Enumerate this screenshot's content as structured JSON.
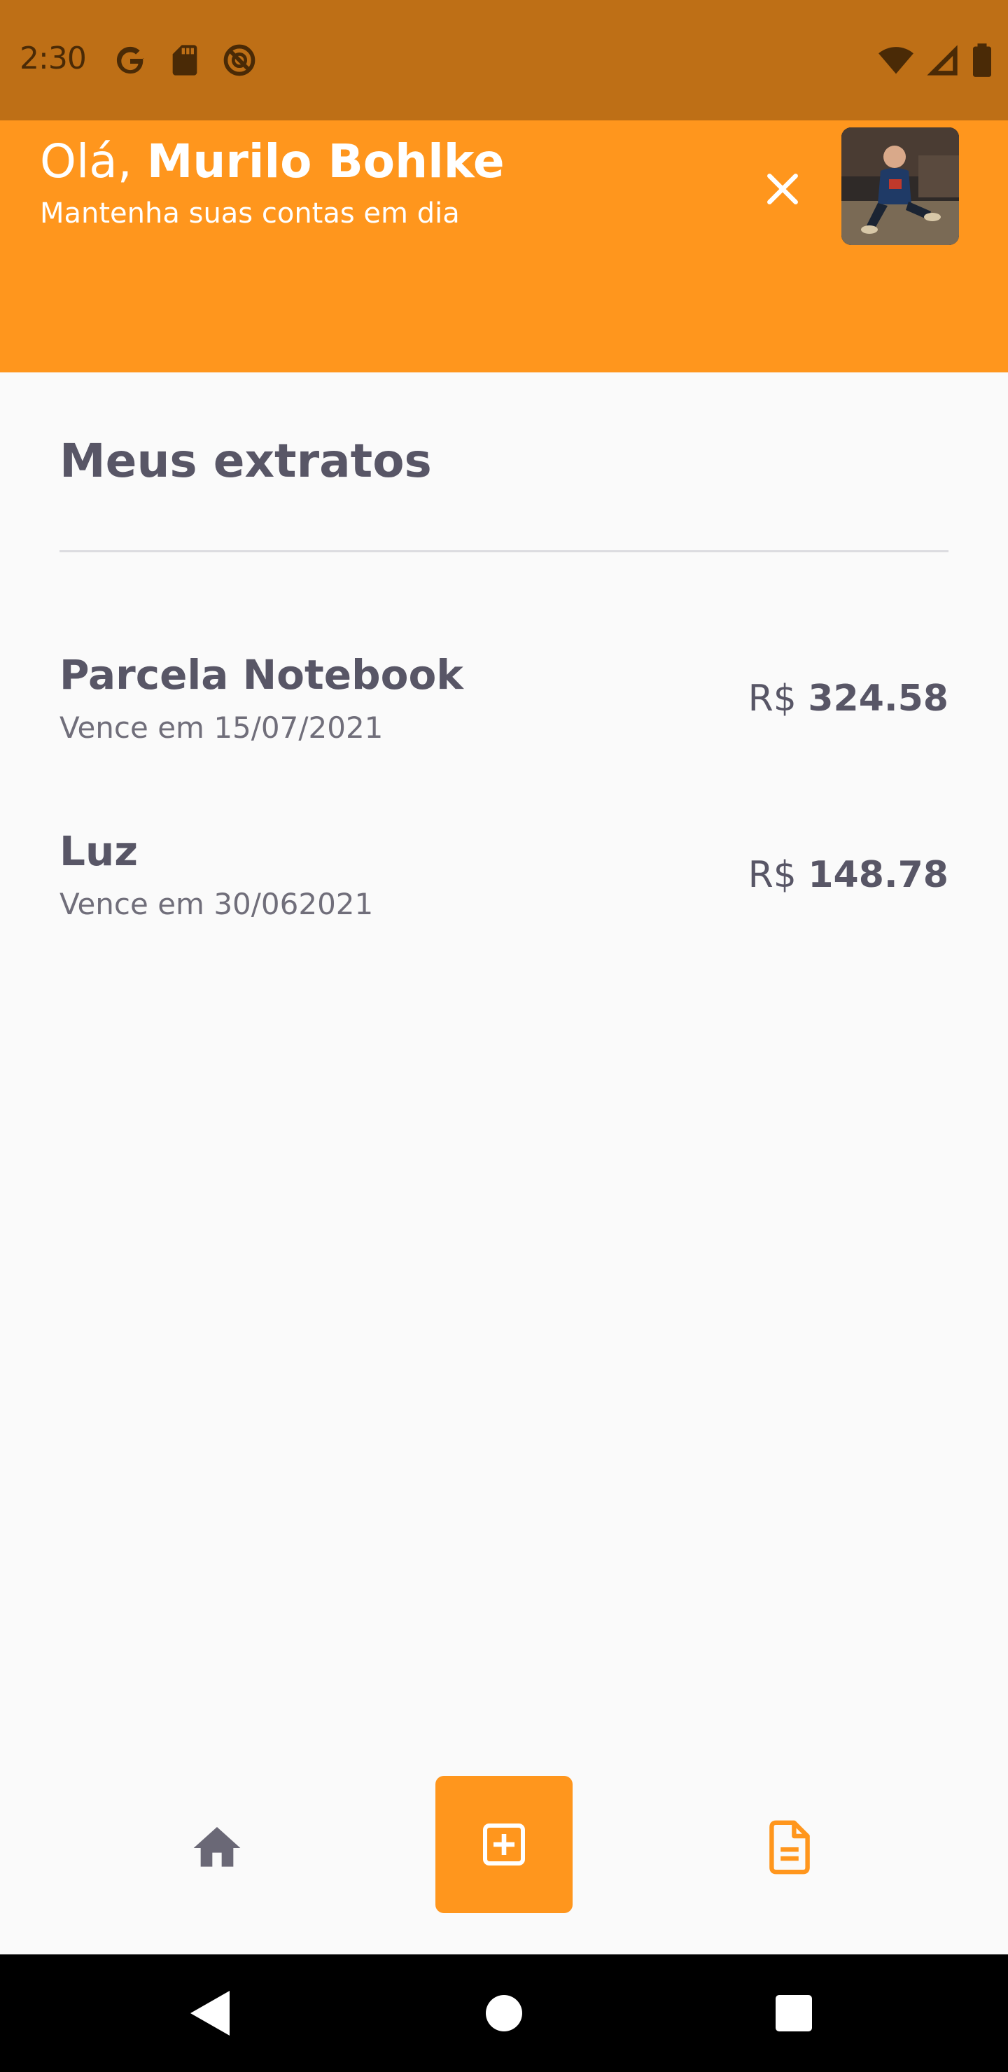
{
  "status_bar": {
    "time": "2:30",
    "left_icons": [
      "google-icon",
      "sd-card-icon",
      "do-not-disturb-icon"
    ],
    "right_icons": [
      "wifi-icon",
      "signal-icon",
      "battery-icon"
    ]
  },
  "header": {
    "greeting_prefix": "Olá, ",
    "user_name": "Murilo Bohlke",
    "subtitle": "Mantenha suas contas em dia",
    "close_icon": "close-icon",
    "avatar": "user-avatar-photo"
  },
  "statements": {
    "title": "Meus extratos",
    "items": [
      {
        "title": "Parcela Notebook",
        "due": "Vence em 15/07/2021",
        "currency": "R$",
        "amount": "324.58"
      },
      {
        "title": "Luz",
        "due": "Vence em 30/062021",
        "currency": "R$",
        "amount": "148.78"
      }
    ]
  },
  "bottom_nav": {
    "items": [
      {
        "icon": "home-icon",
        "active": false
      },
      {
        "icon": "add-box-icon",
        "active": false
      },
      {
        "icon": "document-icon",
        "active": true
      }
    ]
  },
  "system_nav": {
    "icons": [
      "back-icon",
      "home-circle-icon",
      "recents-icon"
    ]
  },
  "colors": {
    "status_bar": "#BE6F16",
    "header": "#FF961D",
    "background": "#FAFAFA",
    "primary_text": "#585666",
    "secondary_text": "#706E7A",
    "accent": "#FF961D"
  }
}
